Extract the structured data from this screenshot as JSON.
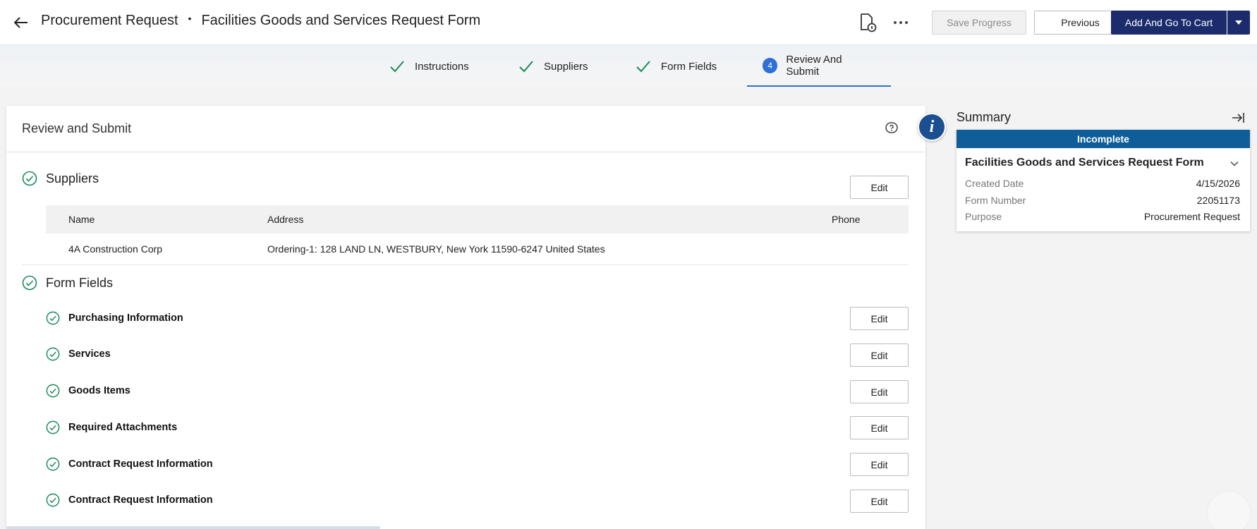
{
  "header": {
    "title_primary": "Procurement Request",
    "title_separator": "•",
    "title_secondary": "Facilities Goods and Services Request Form",
    "save_label": "Save Progress",
    "previous_label": "Previous",
    "cart_label": "Add And Go To Cart"
  },
  "steps": [
    {
      "label": "Instructions",
      "state": "complete"
    },
    {
      "label": "Suppliers",
      "state": "complete"
    },
    {
      "label": "Form Fields",
      "state": "complete"
    },
    {
      "label": "Review And Submit",
      "state": "active",
      "number": "4"
    }
  ],
  "review": {
    "title": "Review and Submit",
    "suppliers": {
      "heading": "Suppliers",
      "edit_label": "Edit",
      "columns": [
        "Name",
        "Address",
        "Phone"
      ],
      "rows": [
        {
          "name": "4A Construction Corp",
          "address": "Ordering-1: 128 LAND LN, WESTBURY, New York 11590-6247 United States",
          "phone": ""
        }
      ]
    },
    "form_fields": {
      "heading": "Form Fields",
      "items": [
        {
          "label": "Purchasing Information",
          "edit_label": "Edit"
        },
        {
          "label": "Services",
          "edit_label": "Edit"
        },
        {
          "label": "Goods Items",
          "edit_label": "Edit"
        },
        {
          "label": "Required Attachments",
          "edit_label": "Edit"
        },
        {
          "label": "Contract Request Information",
          "edit_label": "Edit"
        },
        {
          "label": "Contract Request Information",
          "edit_label": "Edit"
        }
      ]
    }
  },
  "info_glyph": "i",
  "summary": {
    "title": "Summary",
    "status": "Incomplete",
    "form_title": "Facilities Goods and Services Request Form",
    "rows": [
      {
        "label": "Created Date",
        "value": "4/15/2026"
      },
      {
        "label": "Form Number",
        "value": "22051173"
      },
      {
        "label": "Purpose",
        "value": "Procurement Request"
      }
    ]
  },
  "colors": {
    "accent_navy": "#1b2b6b",
    "step_blue": "#2f6fd6",
    "status_blue": "#0f5e99",
    "check_green": "#1a8a5a"
  }
}
